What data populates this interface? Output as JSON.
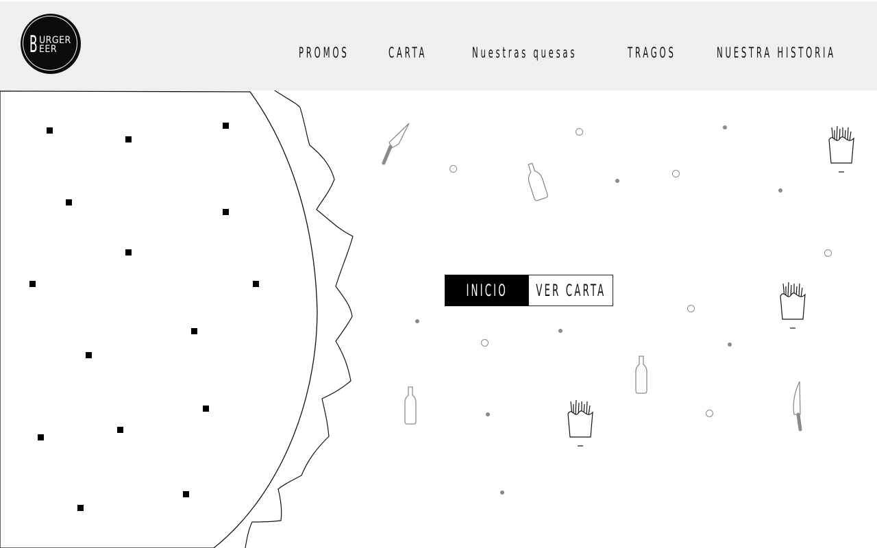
{
  "brand": {
    "big_letter": "B",
    "line1": "URGER",
    "line2": "EER"
  },
  "nav": {
    "items": [
      {
        "label": "PROMOS"
      },
      {
        "label": "CARTA"
      },
      {
        "label": "Nuestras quesas"
      },
      {
        "label": "TRAGOS"
      },
      {
        "label": "NUESTRA HISTORIA"
      }
    ]
  },
  "hero": {
    "primary_button": "INICIO",
    "secondary_button": "VER CARTA"
  },
  "icons": {
    "knife": "knife-icon",
    "bottle": "bottle-icon",
    "fries": "fries-icon"
  },
  "colors": {
    "header_bg": "#efefef",
    "logo_bg": "#0b0b0b",
    "button_dark": "#000000",
    "decor_gray": "#8a8a8a"
  }
}
